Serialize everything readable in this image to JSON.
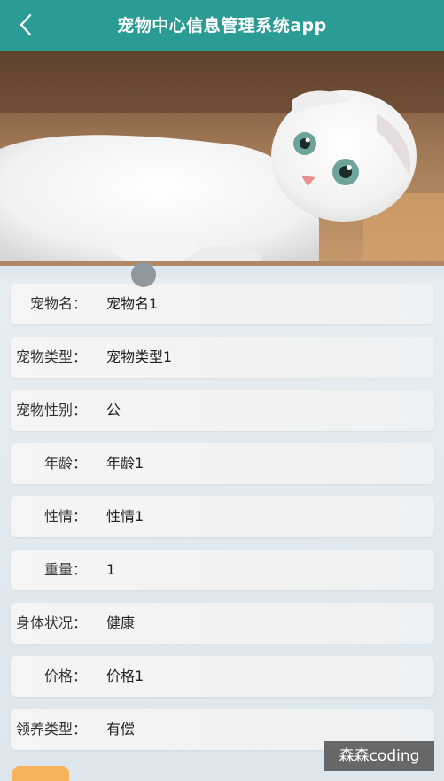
{
  "header": {
    "title": "宠物中心信息管理系统app"
  },
  "details": [
    {
      "label": "宠物名：",
      "value": "宠物名1"
    },
    {
      "label": "宠物类型：",
      "value": "宠物类型1"
    },
    {
      "label": "宠物性别：",
      "value": "公"
    },
    {
      "label": "年龄：",
      "value": "年龄1"
    },
    {
      "label": "性情：",
      "value": "性情1"
    },
    {
      "label": "重量：",
      "value": "1"
    },
    {
      "label": "身体状况：",
      "value": "健康"
    },
    {
      "label": "价格：",
      "value": "价格1"
    },
    {
      "label": "领养类型：",
      "value": "有偿"
    }
  ],
  "watermark": "森森coding",
  "icons": {
    "back": "chevron-left-icon"
  },
  "colors": {
    "header_bg": "#2a9c93",
    "accent_orange": "#f6b35a"
  }
}
